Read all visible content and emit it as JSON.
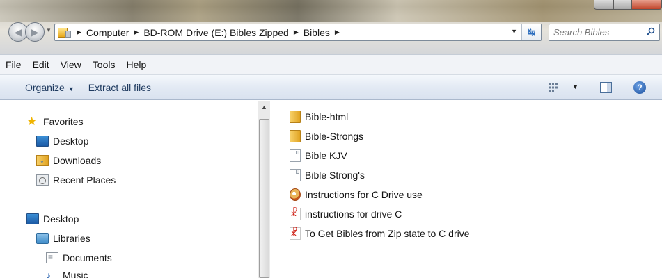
{
  "window": {
    "minimize_icon": "minimize-icon",
    "maximize_icon": "maximize-icon",
    "close_icon": "close-icon"
  },
  "address": {
    "breadcrumbs": [
      "Computer",
      "BD-ROM Drive (E:) Bibles Zipped",
      "Bibles"
    ],
    "separator": "▶"
  },
  "search": {
    "placeholder": "Search Bibles"
  },
  "menu": {
    "items": [
      "File",
      "Edit",
      "View",
      "Tools",
      "Help"
    ]
  },
  "toolbar": {
    "organize_label": "Organize",
    "extract_label": "Extract all files"
  },
  "nav": {
    "favorites": "Favorites",
    "favorites_items": [
      "Desktop",
      "Downloads",
      "Recent Places"
    ],
    "desktop": "Desktop",
    "libraries": "Libraries",
    "documents": "Documents",
    "music": "Music"
  },
  "files": [
    {
      "name": "Bible-html",
      "icon": "folder-icon"
    },
    {
      "name": "Bible-Strongs",
      "icon": "folder-icon"
    },
    {
      "name": "Bible KJV",
      "icon": "document-icon"
    },
    {
      "name": "Bible Strong's",
      "icon": "document-icon"
    },
    {
      "name": "Instructions for C Drive use",
      "icon": "html-file-icon"
    },
    {
      "name": "instructions for drive C",
      "icon": "pdf-icon"
    },
    {
      "name": "To Get Bibles from Zip state to C drive",
      "icon": "pdf-icon"
    }
  ],
  "colors": {
    "toolbar_text": "#1e3a5f",
    "pdf_red": "#d0271d",
    "folder_yellow": "#e0a322"
  }
}
